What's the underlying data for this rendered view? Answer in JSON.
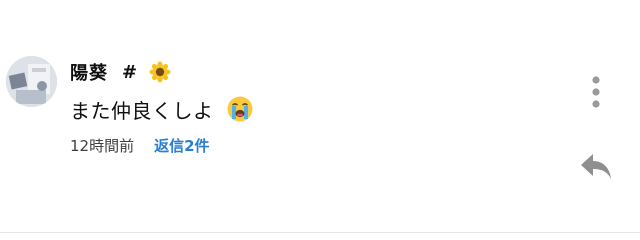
{
  "comment": {
    "author": {
      "name": "陽葵",
      "hash": "#",
      "name_emoji": "sunflower-icon"
    },
    "text": "また仲良くしよ",
    "text_emoji": "loudly-crying-face-icon",
    "timestamp": "12時間前",
    "replies_label": "返信2件",
    "actions": {
      "more_icon": "more-vertical-icon",
      "reply_icon": "reply-arrow-icon"
    }
  },
  "colors": {
    "background": "#ffffff",
    "text": "#0f0f0f",
    "muted": "#404040",
    "link": "#2a7fd0",
    "icon": "#9a9a9a"
  }
}
